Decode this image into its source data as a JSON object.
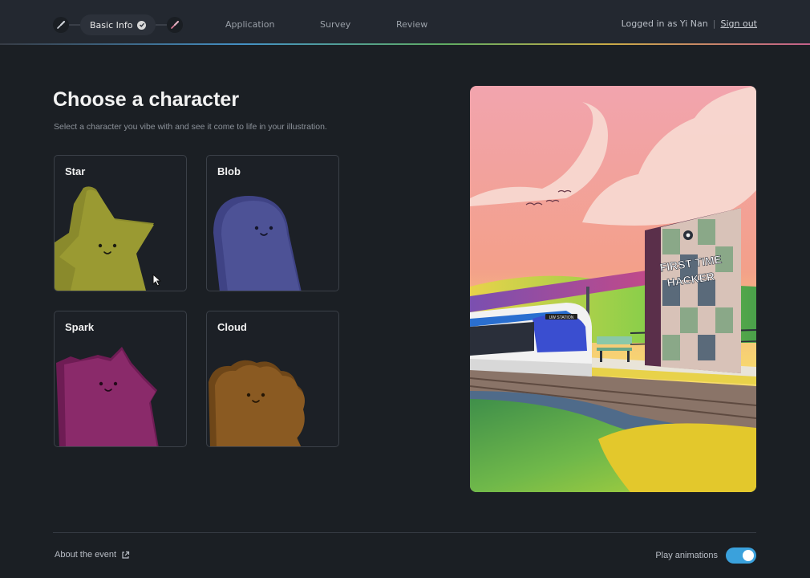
{
  "header": {
    "steps": {
      "current_label": "Basic Info",
      "application": "Application",
      "survey": "Survey",
      "review": "Review"
    },
    "user": {
      "logged_in_text": "Logged in as Yi Nan",
      "separator": "|",
      "sign_out": "Sign out"
    }
  },
  "main": {
    "title": "Choose a character",
    "subtitle": "Select a character you vibe with and see it come to life in your illustration.",
    "characters": [
      {
        "label": "Star",
        "color": "#8a8a2c"
      },
      {
        "label": "Blob",
        "color": "#464b8f"
      },
      {
        "label": "Spark",
        "color": "#8a2a6a"
      },
      {
        "label": "Cloud",
        "color": "#8a5a22"
      }
    ],
    "illustration": {
      "sign_line1": "FIRST TIME",
      "sign_line2": "HACKER",
      "train_display": "UW STATION"
    }
  },
  "footer": {
    "about_link": "About the event",
    "play_animations_label": "Play animations",
    "play_animations_on": true,
    "toggle_color": "#3aa1dc"
  }
}
